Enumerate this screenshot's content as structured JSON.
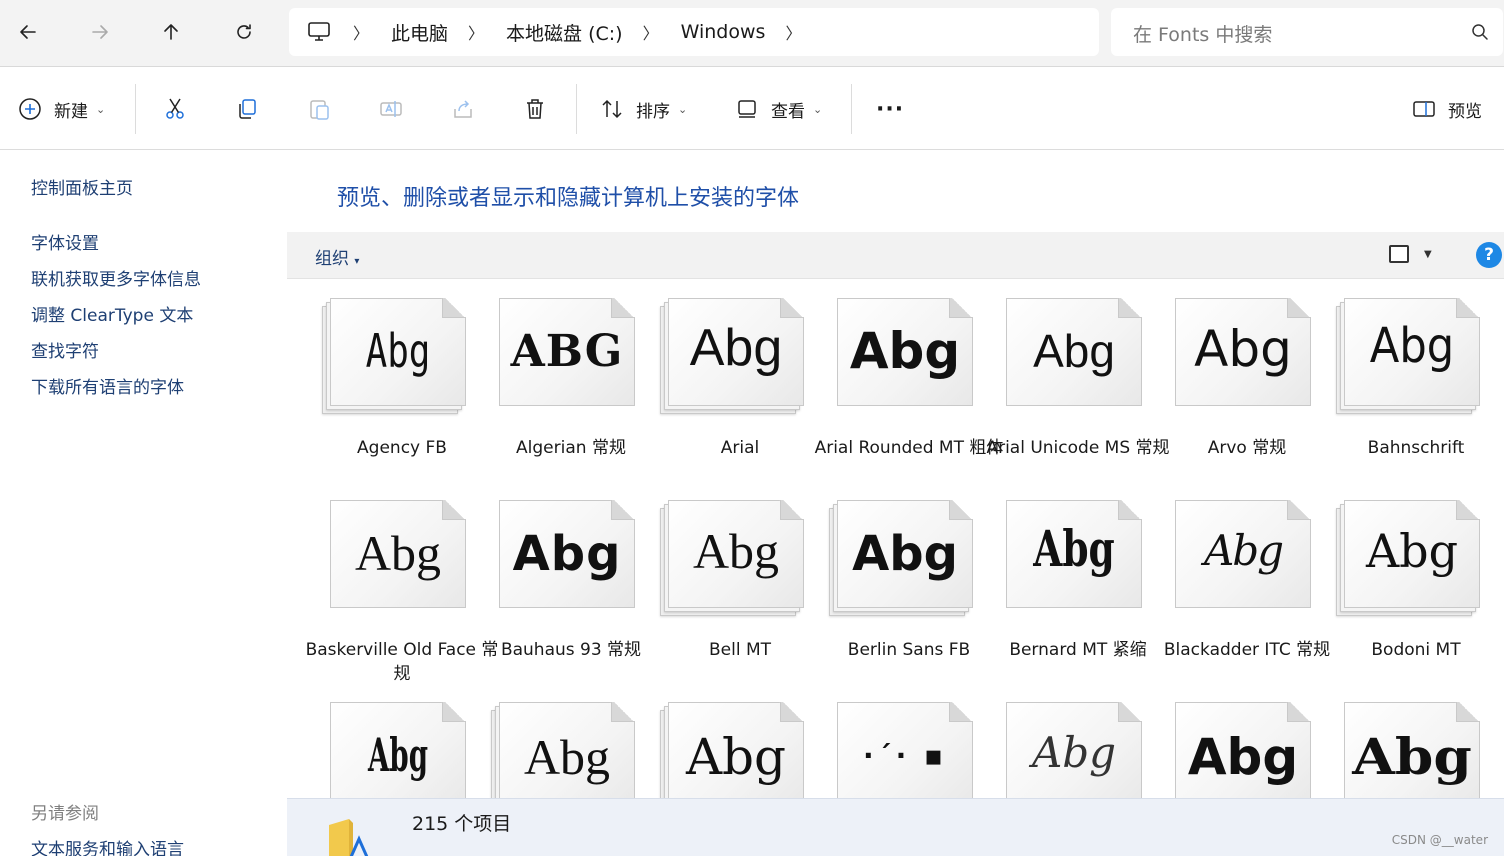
{
  "address": {
    "crumbs": [
      "此电脑",
      "本地磁盘 (C:)",
      "Windows"
    ],
    "search_placeholder": "在 Fonts 中搜索"
  },
  "command_bar": {
    "new_label": "新建",
    "sort_label": "排序",
    "view_label": "查看",
    "more_label": "···",
    "preview_label": "预览"
  },
  "left_pane": {
    "home_link": "控制面板主页",
    "links": [
      "字体设置",
      "联机获取更多字体信息",
      "调整 ClearType 文本",
      "查找字符",
      "下载所有语言的字体"
    ],
    "see_also_heading": "另请参阅",
    "see_also_link": "文本服务和输入语言"
  },
  "main": {
    "title": "预览、删除或者显示和隐藏计算机上安装的字体",
    "organize_label": "组织",
    "help_label": "?"
  },
  "fonts": [
    {
      "name": "Agency FB",
      "sample": "Abg"
    },
    {
      "name": "Algerian 常规",
      "sample": "ABG"
    },
    {
      "name": "Arial",
      "sample": "Abg"
    },
    {
      "name": "Arial Rounded MT 粗体",
      "sample": "Abg"
    },
    {
      "name": "Arial Unicode MS 常规",
      "sample": "Abg"
    },
    {
      "name": "Arvo 常规",
      "sample": "Abg"
    },
    {
      "name": "Bahnschrift",
      "sample": "Abg"
    },
    {
      "name": "Baskerville Old Face 常规",
      "sample": "Abg"
    },
    {
      "name": "Bauhaus 93 常规",
      "sample": "Abg"
    },
    {
      "name": "Bell MT",
      "sample": "Abg"
    },
    {
      "name": "Berlin Sans FB",
      "sample": "Abg"
    },
    {
      "name": "Bernard MT 紧缩",
      "sample": "Abg"
    },
    {
      "name": "Blackadder ITC 常规",
      "sample": "Abg"
    },
    {
      "name": "Bodoni MT",
      "sample": "Abg"
    },
    {
      "name": "",
      "sample": "Abg"
    },
    {
      "name": "",
      "sample": "Abg"
    },
    {
      "name": "",
      "sample": "Abg"
    },
    {
      "name": "",
      "sample": "·ˊ· ▪"
    },
    {
      "name": "",
      "sample": "Abg"
    },
    {
      "name": "",
      "sample": "Abg"
    },
    {
      "name": "",
      "sample": "Abg"
    }
  ],
  "status": {
    "item_count": "215 个项目",
    "watermark": "CSDN @__water"
  }
}
